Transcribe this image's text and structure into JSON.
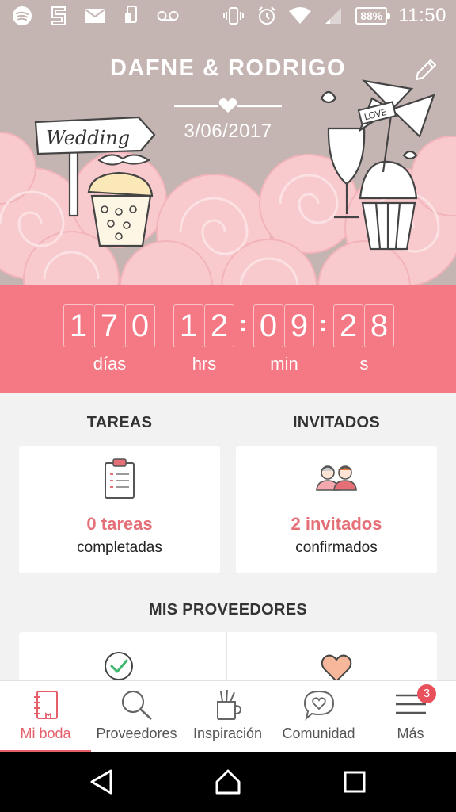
{
  "status_bar": {
    "left_icons": [
      "spotify-icon",
      "s-app-icon",
      "mail-icon",
      "phone-icon",
      "voicemail-icon"
    ],
    "right_icons": [
      "vibrate-icon",
      "alarm-icon",
      "wifi-icon",
      "signal-icon"
    ],
    "battery": "88%",
    "time": "11:50"
  },
  "hero": {
    "couple": "DAFNE & RODRIGO",
    "date": "3/06/2017",
    "sign_text": "Wedding",
    "love_flag_text": "LOVE",
    "edit_icon": "pencil-icon"
  },
  "countdown": {
    "days": [
      "1",
      "7",
      "0"
    ],
    "hours": [
      "1",
      "2"
    ],
    "minutes": [
      "0",
      "9"
    ],
    "seconds": [
      "2",
      "8"
    ],
    "days_label": "días",
    "hours_label": "hrs",
    "minutes_label": "min",
    "seconds_label": "s",
    "separator": ":"
  },
  "tasks": {
    "title": "TAREAS",
    "count": "0 tareas",
    "sub": "completadas",
    "icon": "clipboard-icon"
  },
  "guests": {
    "title": "INVITADOS",
    "count": "2 invitados",
    "sub": "confirmados",
    "icon": "guests-icon"
  },
  "vendors": {
    "title": "MIS PROVEEDORES",
    "icons": [
      "check-circle-icon",
      "heart-icon"
    ]
  },
  "bottom_nav": {
    "items": [
      {
        "label": "Mi boda",
        "icon": "notebook-icon",
        "active": true
      },
      {
        "label": "Proveedores",
        "icon": "search-icon"
      },
      {
        "label": "Inspiración",
        "icon": "inspiration-icon"
      },
      {
        "label": "Comunidad",
        "icon": "chat-heart-icon"
      },
      {
        "label": "Más",
        "icon": "menu-icon",
        "badge": "3"
      }
    ]
  },
  "colors": {
    "accent": "#f47984",
    "hero_bg": "#c4b4b2",
    "active": "#e55f6b"
  }
}
